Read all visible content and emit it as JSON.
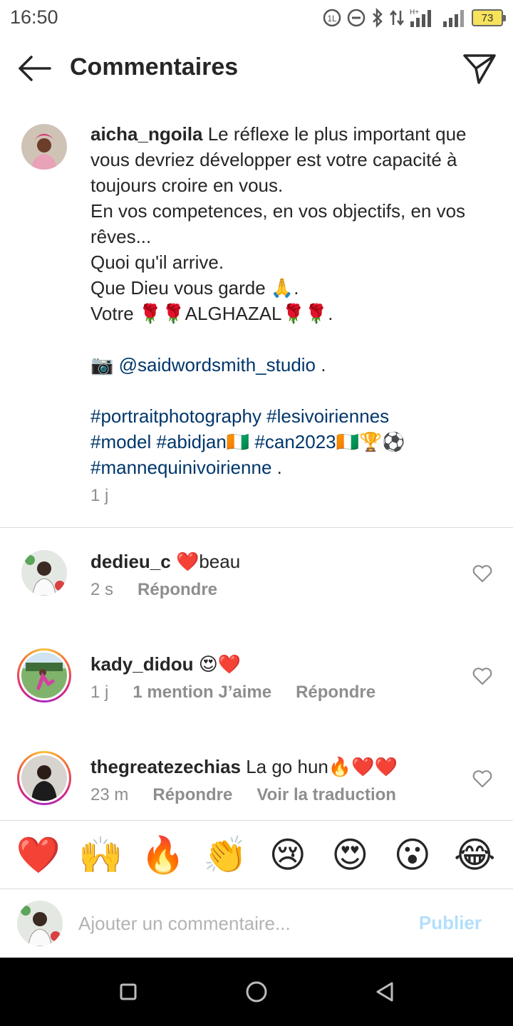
{
  "status_bar": {
    "time": "16:50",
    "battery": "73",
    "icons": [
      "data-saver-icon",
      "do-not-disturb-icon",
      "bluetooth-icon",
      "data-transfer-icon",
      "signal-h-plus-icon",
      "signal-icon",
      "battery-icon"
    ]
  },
  "header": {
    "title": "Commentaires",
    "back_icon": "arrow-left-icon",
    "share_icon": "send-icon"
  },
  "caption": {
    "username": "aicha_ngoila",
    "lines": [
      " Le réflexe le plus important que vous devriez développer est votre capacité à toujours croire en vous.",
      "En vos competences, en vos objectifs, en vos rêves...",
      "Quoi qu'il arrive.",
      "Que Dieu vous garde 🙏.",
      "Votre 🌹🌹ALGHAZAL🌹🌹."
    ],
    "camera_emoji": "📷",
    "mention": "@saidwordsmith_studio",
    "mention_suffix": " .",
    "hashtags_line1": "#portraitphotography #lesivoiriennes",
    "hashtags_line2a": "#model #abidjan",
    "flag1": "🇨🇮",
    "hashtags_line2b": " #can2023",
    "flag2": "🇨🇮",
    "trophy_ball": "🏆⚽",
    "hashtags_line3": "#mannequinivoirienne",
    "hashtags_line3_suffix": " .",
    "time": "1 j"
  },
  "comments": [
    {
      "username": "dedieu_c",
      "text": " ❤️beau",
      "time": "2 s",
      "likes": "",
      "reply": "Répondre",
      "translate": ""
    },
    {
      "username": "kady_didou",
      "text": " 😍❤️",
      "time": "1 j",
      "likes": "1 mention J’aime",
      "reply": "Répondre",
      "translate": ""
    },
    {
      "username": "thegreatezechias",
      "text": " La go hun🔥❤️❤️",
      "time": "23 m",
      "likes": "",
      "reply": "Répondre",
      "translate": "Voir la traduction"
    }
  ],
  "emoji_bar": [
    "❤️",
    "🙌",
    "🔥",
    "👏",
    "😢",
    "😍",
    "😮",
    "😂"
  ],
  "add_comment": {
    "placeholder": "Ajouter un commentaire...",
    "publish": "Publier"
  },
  "colors": {
    "link": "#00376b",
    "secondary_text": "#8e8e8e",
    "publish_disabled": "#b2dffc",
    "divider": "#dbdbdb"
  }
}
